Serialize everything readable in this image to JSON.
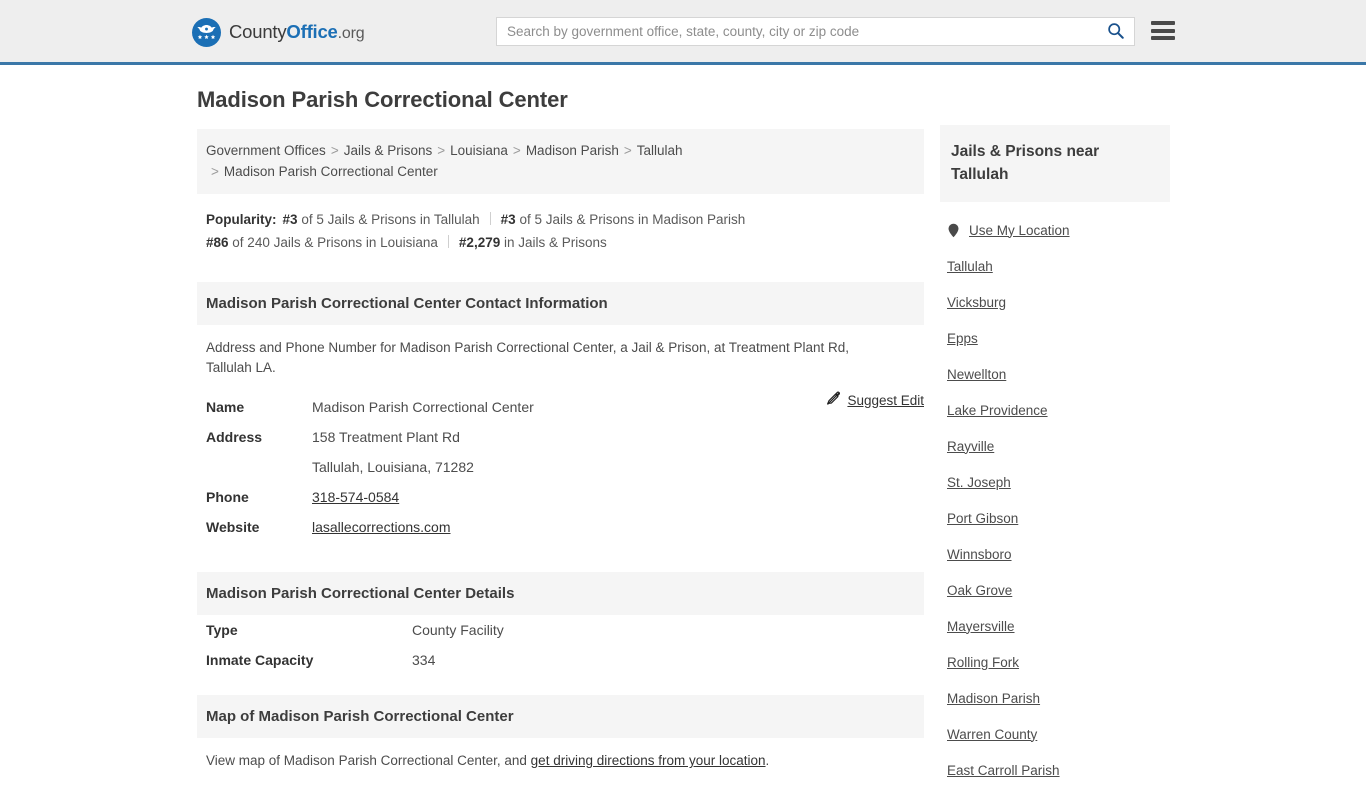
{
  "header": {
    "logo_county": "County",
    "logo_office": "Office",
    "logo_org": ".org",
    "search_placeholder": "Search by government office, state, county, city or zip code",
    "search_value": "",
    "search_icon": "search-icon",
    "menu_icon": "hamburger-menu-icon"
  },
  "page": {
    "title": "Madison Parish Correctional Center"
  },
  "breadcrumb": {
    "separator": ">",
    "items": [
      "Government Offices",
      "Jails & Prisons",
      "Louisiana",
      "Madison Parish",
      "Tallulah",
      "Madison Parish Correctional Center"
    ]
  },
  "popularity": {
    "label": "Popularity:",
    "items": [
      {
        "rank": "#3",
        "text": "of 5 Jails & Prisons in Tallulah"
      },
      {
        "rank": "#3",
        "text": "of 5 Jails & Prisons in Madison Parish"
      },
      {
        "rank": "#86",
        "text": "of 240 Jails & Prisons in Louisiana"
      },
      {
        "rank": "#2,279",
        "text": "in Jails & Prisons"
      }
    ]
  },
  "contact": {
    "section_title": "Madison Parish Correctional Center Contact Information",
    "description": "Address and Phone Number for Madison Parish Correctional Center, a Jail & Prison, at Treatment Plant Rd, Tallulah LA.",
    "suggest_edit_label": "Suggest Edit",
    "suggest_edit_icon": "edit-pencil-icon",
    "rows": [
      {
        "key": "Name",
        "value": "Madison Parish Correctional Center",
        "link": false
      },
      {
        "key": "Address",
        "value": "158 Treatment Plant Rd",
        "link": false
      },
      {
        "key": "",
        "value": "Tallulah, Louisiana, 71282",
        "link": false
      },
      {
        "key": "Phone",
        "value": "318-574-0584",
        "link": true
      },
      {
        "key": "Website",
        "value": "lasallecorrections.com",
        "link": true
      }
    ]
  },
  "details": {
    "section_title": "Madison Parish Correctional Center Details",
    "rows": [
      {
        "key": "Type",
        "value": "County Facility"
      },
      {
        "key": "Inmate Capacity",
        "value": "334"
      }
    ]
  },
  "map": {
    "section_title": "Map of Madison Parish Correctional Center",
    "desc_prefix": "View map of Madison Parish Correctional Center, and ",
    "desc_link": "get driving directions from your location",
    "desc_suffix": "."
  },
  "sidebar": {
    "heading": "Jails & Prisons near Tallulah",
    "use_my_location": "Use My Location",
    "pin_icon": "map-pin-icon",
    "items": [
      "Tallulah",
      "Vicksburg",
      "Epps",
      "Newellton",
      "Lake Providence",
      "Rayville",
      "St. Joseph",
      "Port Gibson",
      "Winnsboro",
      "Oak Grove",
      "Mayersville",
      "Rolling Fork",
      "Madison Parish",
      "Warren County",
      "East Carroll Parish"
    ]
  },
  "colors": {
    "brand_blue": "#1b6fb5",
    "header_rule": "#3b77a8",
    "header_bg": "#eeeeee",
    "panel_bg": "#f5f5f5"
  }
}
